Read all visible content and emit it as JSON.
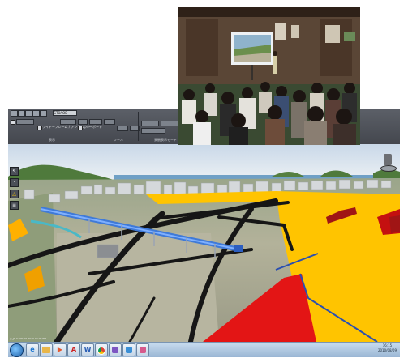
{
  "app": {
    "ribbon": {
      "combo_value": "GTOAOD",
      "check1_label": "ワイヤーフレーム / アンビエント",
      "check2_label": "ビューポート",
      "group_labels": [
        "表示",
        "ツール",
        "景観表示モード"
      ]
    },
    "left_toolbar": {
      "icons": [
        "select-icon",
        "measure-icon",
        "warning-icon",
        "layers-icon"
      ]
    },
    "navigation_widget_icon": "navigation-cube-icon",
    "status_bar": {
      "text": "ja_JP 0.000 16-2010.08.09 PM"
    }
  },
  "taskbar": {
    "items": [
      {
        "icon": "start-icon"
      },
      {
        "icon": "internet-explorer-icon",
        "letter": "e",
        "color": "#1f78d1"
      },
      {
        "icon": "explorer-folder-icon",
        "letter": "",
        "color": "#e8b64a"
      },
      {
        "icon": "media-player-icon",
        "letter": "▶",
        "color": "#e4572e"
      },
      {
        "icon": "pdf-icon",
        "letter": "A",
        "color": "#cc1f1f"
      },
      {
        "icon": "word-icon",
        "letter": "W",
        "color": "#2b5fb5"
      },
      {
        "icon": "chrome-icon",
        "letter": "",
        "color": "#3aa757"
      },
      {
        "icon": "paint-icon",
        "letter": "",
        "color": "#7d56c2"
      },
      {
        "icon": "remote-icon",
        "letter": "",
        "color": "#3a8fd6"
      },
      {
        "icon": "app-icon",
        "letter": "",
        "color": "#d65a8c"
      }
    ],
    "clock_time": "16:15",
    "clock_date": "2010/08/09"
  },
  "colors": {
    "viaduct": "#3f7ad8",
    "zone_yellow": "#ffc400",
    "zone_red": "#e31515",
    "road": "#161616",
    "sea": "#6fa0c6",
    "sky": "#dfe7f0"
  }
}
